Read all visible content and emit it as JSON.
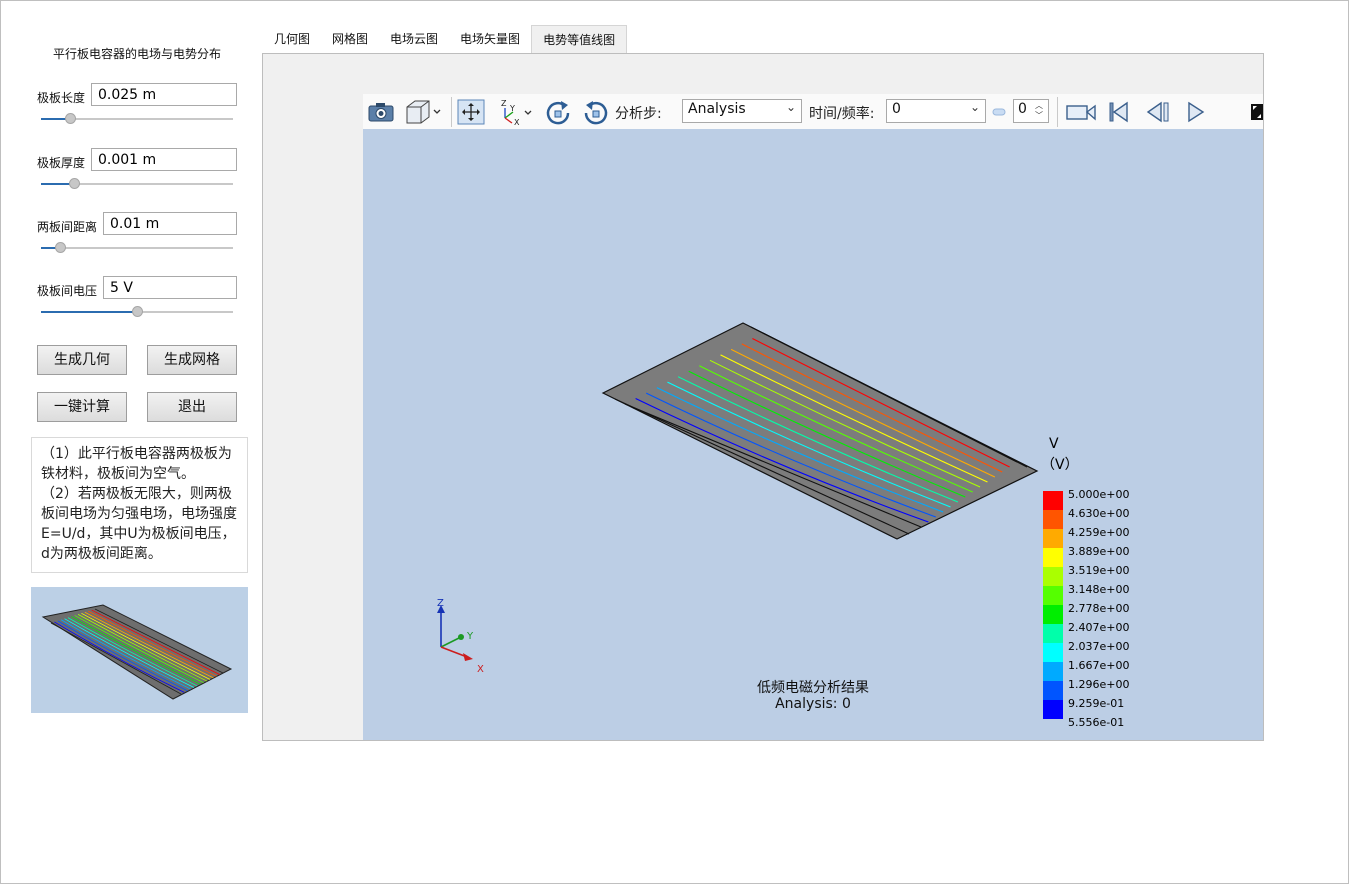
{
  "panel": {
    "title": "平行板电容器的电场与电势分布",
    "params": [
      {
        "label": "极板长度",
        "value": "0.025 m",
        "slider_fraction": 0.15
      },
      {
        "label": "极板厚度",
        "value": "0.001 m",
        "slider_fraction": 0.17
      },
      {
        "label": "两板间距离",
        "value": "0.01 m",
        "slider_fraction": 0.1
      },
      {
        "label": "极板间电压",
        "value": "5 V",
        "slider_fraction": 0.5
      }
    ],
    "buttons": {
      "gen_geometry": "生成几何",
      "gen_mesh": "生成网格",
      "compute": "一键计算",
      "exit": "退出"
    },
    "notes": [
      "（1）此平行板电容器两极板为铁材料，极板间为空气。",
      "（2）若两极板无限大，则两极板间电场为匀强电场，电场强度E=U/d，其中U为极板间电压，d为两极板间距离。"
    ]
  },
  "tabs": [
    {
      "label": "几何图",
      "active": false
    },
    {
      "label": "网格图",
      "active": false
    },
    {
      "label": "电场云图",
      "active": false
    },
    {
      "label": "电场矢量图",
      "active": false
    },
    {
      "label": "电势等值线图",
      "active": true
    }
  ],
  "toolbar": {
    "step_label": "分析步:",
    "step_value": "Analysis",
    "time_label": "时间/频率:",
    "time_value": "0",
    "spin_value": "0",
    "icons": [
      "camera-icon",
      "cube-view-icon",
      "pan-icon",
      "axes-icon",
      "rotate-cw-icon",
      "rotate-ccw-icon",
      "record-icon",
      "first-frame-icon",
      "prev-frame-icon",
      "play-icon",
      "fullscreen-icon"
    ]
  },
  "axes": {
    "x": "X",
    "y": "Y",
    "z": "Z"
  },
  "legend": {
    "title": "V",
    "unit": "（V）",
    "levels": [
      {
        "value": "5.000e+00",
        "color": "#ff0000"
      },
      {
        "value": "4.630e+00",
        "color": "#ff5500"
      },
      {
        "value": "4.259e+00",
        "color": "#ffaa00"
      },
      {
        "value": "3.889e+00",
        "color": "#ffff00"
      },
      {
        "value": "3.519e+00",
        "color": "#aaff00"
      },
      {
        "value": "3.148e+00",
        "color": "#55ff00"
      },
      {
        "value": "2.778e+00",
        "color": "#00ee00"
      },
      {
        "value": "2.407e+00",
        "color": "#00ffaa"
      },
      {
        "value": "2.037e+00",
        "color": "#00ffff"
      },
      {
        "value": "1.667e+00",
        "color": "#00aaff"
      },
      {
        "value": "1.296e+00",
        "color": "#0055ff"
      },
      {
        "value": "9.259e-01",
        "color": "#0000ff"
      },
      {
        "value": "5.556e-01",
        "color": null
      }
    ]
  },
  "result": {
    "title": "低频电磁分析结果",
    "subtitle": "Analysis: 0"
  }
}
